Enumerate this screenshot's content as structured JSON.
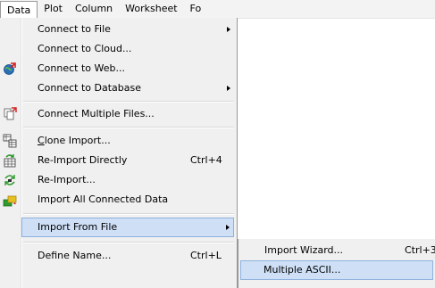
{
  "menubar": {
    "items": [
      "Data",
      "Plot",
      "Column",
      "Worksheet",
      "Fo"
    ]
  },
  "data_menu": {
    "connect_file": "Connect to File",
    "connect_cloud": "Connect to Cloud...",
    "connect_web": "Connect to Web...",
    "connect_database": "Connect to Database",
    "connect_multiple": "Connect Multiple Files...",
    "clone_import": "Clone Import...",
    "reimport_directly": "Re-Import Directly",
    "reimport_directly_shortcut": "Ctrl+4",
    "reimport": "Re-Import...",
    "import_all_connected": "Import All Connected Data",
    "import_from_file": "Import From File",
    "define_name": "Define Name...",
    "define_name_shortcut": "Ctrl+L"
  },
  "import_submenu": {
    "import_wizard": "Import Wizard...",
    "import_wizard_shortcut": "Ctrl+3",
    "multiple_ascii": "Multiple ASCII..."
  }
}
